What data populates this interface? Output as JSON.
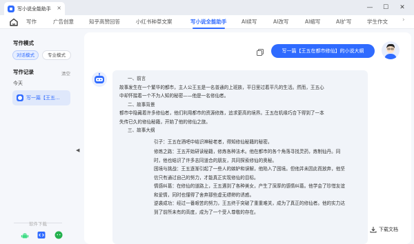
{
  "window": {
    "tab_title": "写小说全能助手",
    "tab_close": "×",
    "minimize": "—",
    "maximize": "☐",
    "close": "✕"
  },
  "nav": {
    "items": [
      {
        "label": "写作"
      },
      {
        "label": "广告创意"
      },
      {
        "label": "知乎高赞回答"
      },
      {
        "label": "小红书种草文案"
      },
      {
        "label": "写小说全能助手",
        "active": true
      },
      {
        "label": "AI续写"
      },
      {
        "label": "AI改写"
      },
      {
        "label": "AI缩写"
      },
      {
        "label": "AI扩写"
      },
      {
        "label": "学生作文"
      }
    ],
    "more": "›"
  },
  "sidebar": {
    "mode_title": "写作模式",
    "mode_active": "对话模式",
    "mode_inactive": "专业模式",
    "records_title": "写作记录",
    "clear": "清空",
    "today": "今天",
    "record_item": "写一篇【王五...",
    "download_label": "软件下载"
  },
  "chat": {
    "user_message": "写一篇【王五在都市修仙】的小说大纲",
    "answer": {
      "section1_title": "一、前言",
      "section1_body": [
        "故事发生在一个繁华的都市，主人公王五是一名普通的上班族，平日里过着平凡的生活。然而，王五心",
        "中却怀揣着一个不为人知的秘密——他是一名修仙者。"
      ],
      "section2_title": "二、故事背景",
      "section2_body": [
        "都市中隐藏着许多修仙者，他们利用都市的资源修炼，追求更高的境界。王五在机缘巧合下得到了一本",
        "失传已久的修仙秘籍，开始了他的修仙之旅。"
      ],
      "section3_title": "三、故事大纲",
      "outline": [
        [
          "引子：王五在酒吧中结识神秘老者，得知修仙秘籍的秘密。"
        ],
        [
          "修炼之路：王五开始研读秘籍，修炼各种法术。他在都市的各个角落寻找灵药，炼制仙丹。同",
          "时，他也结识了许多志同道合的朋友，共同探索修仙的奥秘。"
        ],
        [
          "困境与挑战：王五逐渐引起了一些人的嫉妒和误解，他陷入了困境。但他并未因此而放弃，他坚",
          "信只有通过自己的努力，才能真正实现修仙的目标。"
        ],
        [
          "情感纠葛：在修仙的道路上，王五遇到了各种美女，产生了深厚的感情纠葛。他学会了珍惜友谊",
          "和爱情，同时也懂得了舍弃那些虚无缥缈的诱惑。"
        ],
        [
          "逆袭成功：经过一番艰苦的努力，王五终于突破了重重难关，成为了真正的修仙者。他的实力达",
          "到了前所未有的高度，成为了一个受人尊敬的存在。"
        ]
      ]
    },
    "download_doc": "下载文档"
  },
  "colors": {
    "accent": "#2f6bff",
    "panel_bg": "#f1f4f9"
  }
}
